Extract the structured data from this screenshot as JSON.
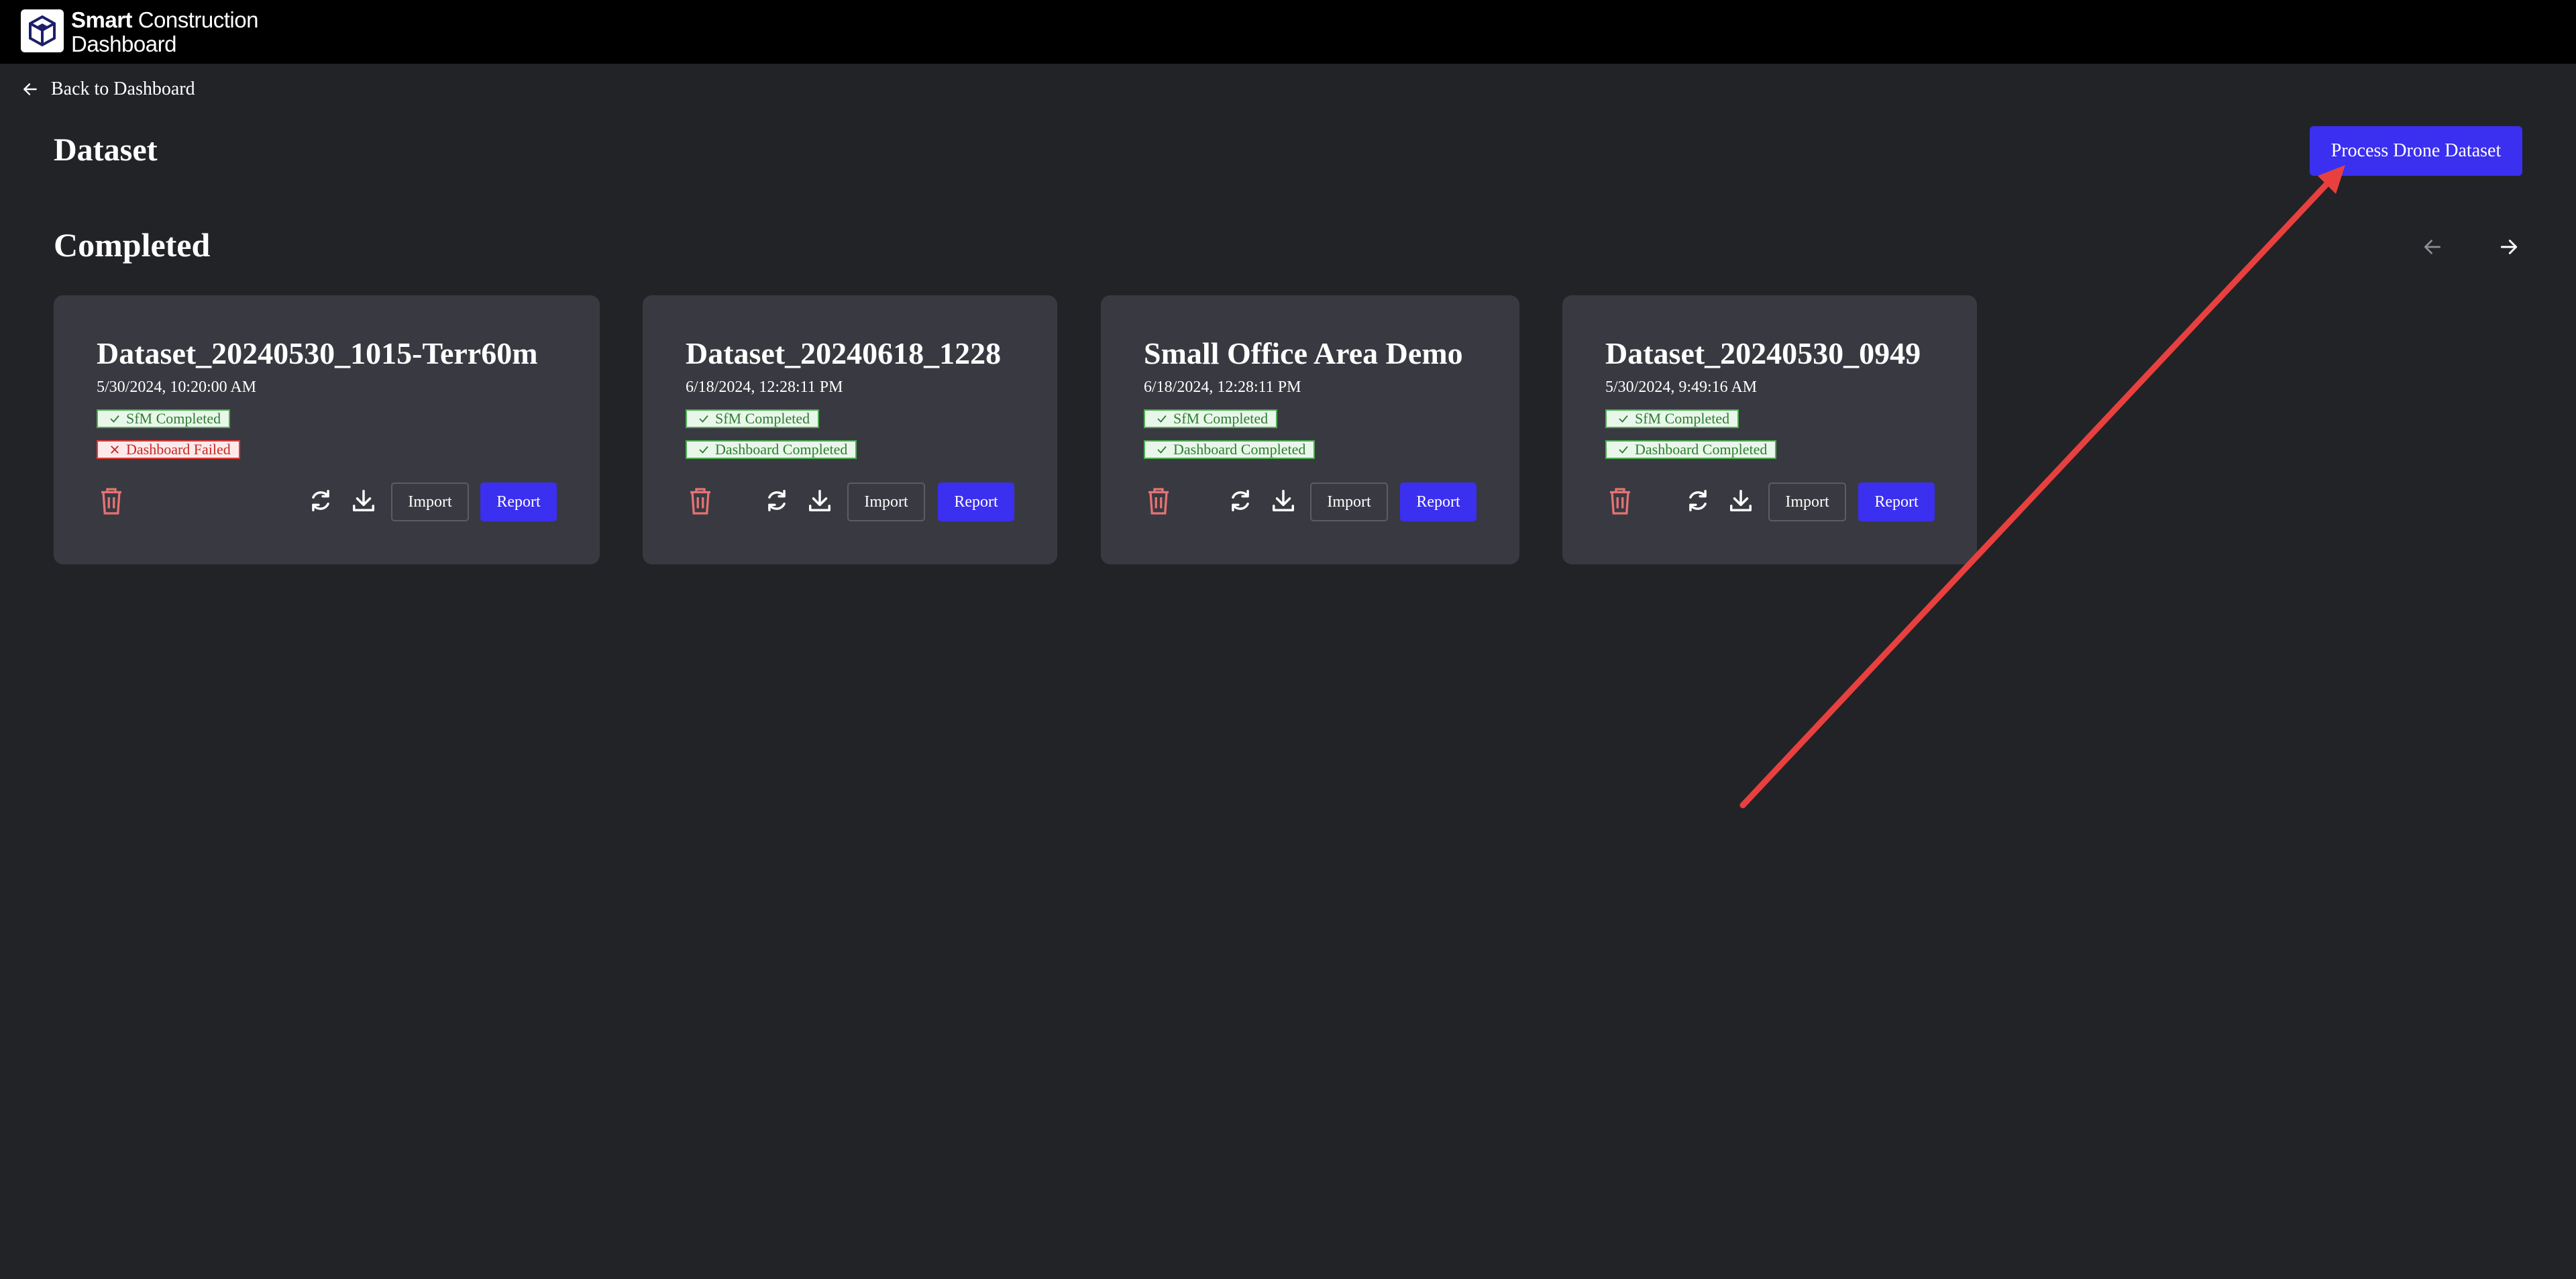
{
  "app": {
    "brand_bold": "Smart",
    "brand_rest": "Construction",
    "brand_line2": "Dashboard"
  },
  "nav": {
    "back_label": "Back to Dashboard"
  },
  "page": {
    "title": "Dataset",
    "primary_action": "Process Drone Dataset",
    "section_title": "Completed"
  },
  "colors": {
    "accent": "#3b2ff0",
    "background": "#222327",
    "card": "#393a41",
    "success": "#4caf50",
    "error": "#e53935",
    "annotation_arrow": "#e8403f"
  },
  "datasets": [
    {
      "name": "Dataset_20240530_1015-Terr60m",
      "date": "5/30/2024, 10:20:00 AM",
      "sfm_status": "SfM Completed",
      "dashboard_status": "Dashboard Failed",
      "dashboard_ok": false,
      "import_label": "Import",
      "report_label": "Report"
    },
    {
      "name": "Dataset_20240618_1228",
      "date": "6/18/2024, 12:28:11 PM",
      "sfm_status": "SfM Completed",
      "dashboard_status": "Dashboard Completed",
      "dashboard_ok": true,
      "import_label": "Import",
      "report_label": "Report"
    },
    {
      "name": "Small Office Area Demo",
      "date": "6/18/2024, 12:28:11 PM",
      "sfm_status": "SfM Completed",
      "dashboard_status": "Dashboard Completed",
      "dashboard_ok": true,
      "import_label": "Import",
      "report_label": "Report"
    },
    {
      "name": "Dataset_20240530_0949",
      "date": "5/30/2024, 9:49:16 AM",
      "sfm_status": "SfM Completed",
      "dashboard_status": "Dashboard Completed",
      "dashboard_ok": true,
      "import_label": "Import",
      "report_label": "Report"
    }
  ],
  "icons": {
    "logo": "cube-logo-icon",
    "back": "arrow-left-icon",
    "prev": "arrow-left-icon",
    "next": "arrow-right-icon",
    "delete": "trash-icon",
    "refresh": "refresh-icon",
    "download": "download-icon",
    "check": "check-icon",
    "fail": "x-icon"
  }
}
